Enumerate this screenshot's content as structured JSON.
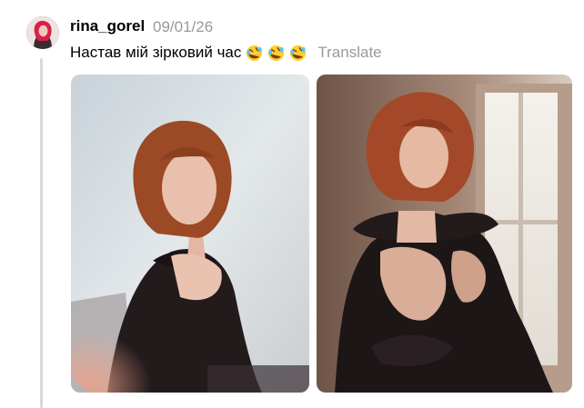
{
  "post": {
    "username": "rina_gorel",
    "timestamp": "09/01/26",
    "caption": "Настав мій зірковий час",
    "caption_emojis": [
      "rolling-on-floor-laughing-icon",
      "rolling-on-floor-laughing-icon",
      "rolling-on-floor-laughing-icon"
    ],
    "translate_label": "Translate"
  },
  "colors": {
    "text": "#000000",
    "muted": "#999999",
    "thread_line": "#d9d9d9"
  }
}
